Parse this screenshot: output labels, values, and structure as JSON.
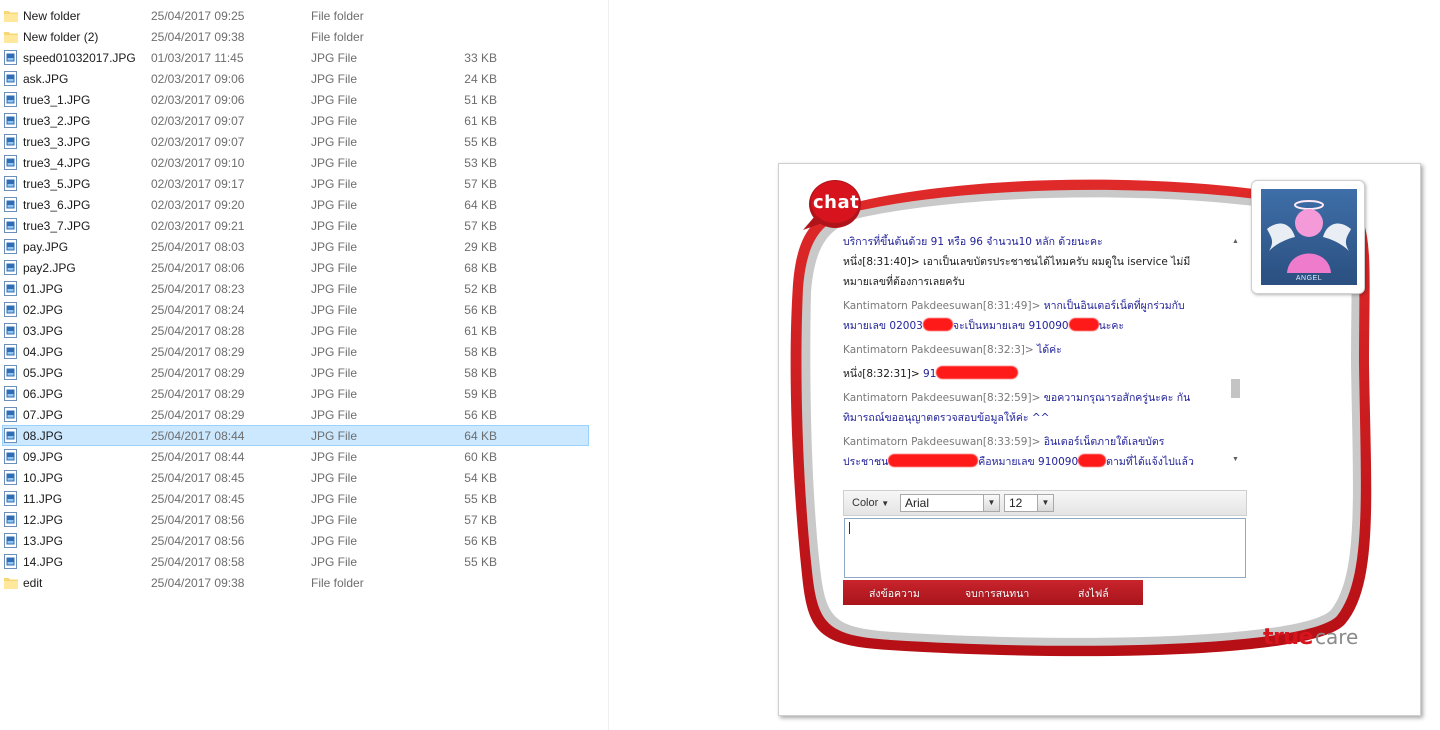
{
  "explorer": {
    "files": [
      {
        "name": "New folder",
        "date": "25/04/2017 09:25",
        "type": "File folder",
        "size": "",
        "kind": "folder"
      },
      {
        "name": "New folder (2)",
        "date": "25/04/2017 09:38",
        "type": "File folder",
        "size": "",
        "kind": "folder"
      },
      {
        "name": "speed01032017.JPG",
        "date": "01/03/2017 11:45",
        "type": "JPG File",
        "size": "33 KB",
        "kind": "image"
      },
      {
        "name": "ask.JPG",
        "date": "02/03/2017 09:06",
        "type": "JPG File",
        "size": "24 KB",
        "kind": "image"
      },
      {
        "name": "true3_1.JPG",
        "date": "02/03/2017 09:06",
        "type": "JPG File",
        "size": "51 KB",
        "kind": "image"
      },
      {
        "name": "true3_2.JPG",
        "date": "02/03/2017 09:07",
        "type": "JPG File",
        "size": "61 KB",
        "kind": "image"
      },
      {
        "name": "true3_3.JPG",
        "date": "02/03/2017 09:07",
        "type": "JPG File",
        "size": "55 KB",
        "kind": "image"
      },
      {
        "name": "true3_4.JPG",
        "date": "02/03/2017 09:10",
        "type": "JPG File",
        "size": "53 KB",
        "kind": "image"
      },
      {
        "name": "true3_5.JPG",
        "date": "02/03/2017 09:17",
        "type": "JPG File",
        "size": "57 KB",
        "kind": "image"
      },
      {
        "name": "true3_6.JPG",
        "date": "02/03/2017 09:20",
        "type": "JPG File",
        "size": "64 KB",
        "kind": "image"
      },
      {
        "name": "true3_7.JPG",
        "date": "02/03/2017 09:21",
        "type": "JPG File",
        "size": "57 KB",
        "kind": "image"
      },
      {
        "name": "pay.JPG",
        "date": "25/04/2017 08:03",
        "type": "JPG File",
        "size": "29 KB",
        "kind": "image"
      },
      {
        "name": "pay2.JPG",
        "date": "25/04/2017 08:06",
        "type": "JPG File",
        "size": "68 KB",
        "kind": "image"
      },
      {
        "name": "01.JPG",
        "date": "25/04/2017 08:23",
        "type": "JPG File",
        "size": "52 KB",
        "kind": "image"
      },
      {
        "name": "02.JPG",
        "date": "25/04/2017 08:24",
        "type": "JPG File",
        "size": "56 KB",
        "kind": "image"
      },
      {
        "name": "03.JPG",
        "date": "25/04/2017 08:28",
        "type": "JPG File",
        "size": "61 KB",
        "kind": "image"
      },
      {
        "name": "04.JPG",
        "date": "25/04/2017 08:29",
        "type": "JPG File",
        "size": "58 KB",
        "kind": "image"
      },
      {
        "name": "05.JPG",
        "date": "25/04/2017 08:29",
        "type": "JPG File",
        "size": "58 KB",
        "kind": "image"
      },
      {
        "name": "06.JPG",
        "date": "25/04/2017 08:29",
        "type": "JPG File",
        "size": "59 KB",
        "kind": "image"
      },
      {
        "name": "07.JPG",
        "date": "25/04/2017 08:29",
        "type": "JPG File",
        "size": "56 KB",
        "kind": "image"
      },
      {
        "name": "08.JPG",
        "date": "25/04/2017 08:44",
        "type": "JPG File",
        "size": "64 KB",
        "kind": "image",
        "selected": true
      },
      {
        "name": "09.JPG",
        "date": "25/04/2017 08:44",
        "type": "JPG File",
        "size": "60 KB",
        "kind": "image"
      },
      {
        "name": "10.JPG",
        "date": "25/04/2017 08:45",
        "type": "JPG File",
        "size": "54 KB",
        "kind": "image"
      },
      {
        "name": "11.JPG",
        "date": "25/04/2017 08:45",
        "type": "JPG File",
        "size": "55 KB",
        "kind": "image"
      },
      {
        "name": "12.JPG",
        "date": "25/04/2017 08:56",
        "type": "JPG File",
        "size": "57 KB",
        "kind": "image"
      },
      {
        "name": "13.JPG",
        "date": "25/04/2017 08:56",
        "type": "JPG File",
        "size": "56 KB",
        "kind": "image"
      },
      {
        "name": "14.JPG",
        "date": "25/04/2017 08:58",
        "type": "JPG File",
        "size": "55 KB",
        "kind": "image"
      },
      {
        "name": "edit",
        "date": "25/04/2017 09:38",
        "type": "File folder",
        "size": "",
        "kind": "folder"
      }
    ]
  },
  "chat": {
    "bubble_label": "chat",
    "avatar_caption": "ANGEL",
    "messages": {
      "m1_body": "บริการที่ขึ้นต้นด้วย 91 หรือ 96 จำนวน10 หลัก ด้วยนะคะ",
      "m2_sender": "หนึ่ง[8:31:40]>",
      "m2_body1": " เอาเป็นเลขบัตรประชาชนได้ไหมครับ ผมดูใน iservice ไม่มี",
      "m2_body2": "หมายเลขที่ต้องการเลยครับ",
      "m3_sender": "Kantimatorn Pakdeesuwan[8:31:49]>",
      "m3_body1": " หากเป็นอินเตอร์เน็ตที่ผูกร่วมกับ",
      "m3_body2a": "หมายเลข 02003",
      "m3_body2b": "จะเป็นหมายเลข 910090",
      "m3_body2c": "นะคะ",
      "m4_sender": "Kantimatorn Pakdeesuwan[8:32:3]>",
      "m4_body": " ได้ค่ะ",
      "m5_sender": "หนึ่ง[8:32:31]>",
      "m5_body": " 91",
      "m6_sender": "Kantimatorn Pakdeesuwan[8:32:59]>",
      "m6_body1": " ขอความกรุณารอสักครู่นะคะ กัน",
      "m6_body2": "ทิมารถณ์ขออนุญาตตรวจสอบข้อมูลให้ค่ะ ^^",
      "m7_sender": "Kantimatorn Pakdeesuwan[8:33:59]>",
      "m7_body1": " อินเตอร์เน็ตภายใต้เลขบัตร",
      "m7_body2a": "ประชาชน",
      "m7_body2b": "คือหมายเลข 910090",
      "m7_body2c": "ตามที่ได้แจ้งไปแล้ว"
    },
    "toolbar": {
      "color_label": "Color",
      "font_value": "Arial",
      "size_value": "12"
    },
    "input_value": "",
    "actions": {
      "send_message": "ส่งข้อความ",
      "end_chat": "จบการสนทนา",
      "send_file": "ส่งไฟล์"
    },
    "logo": {
      "part1": "true",
      "part2": "care"
    },
    "colors": {
      "brand_red": "#d7141d",
      "agent_text": "#23239a",
      "selection": "#cce8ff"
    }
  }
}
